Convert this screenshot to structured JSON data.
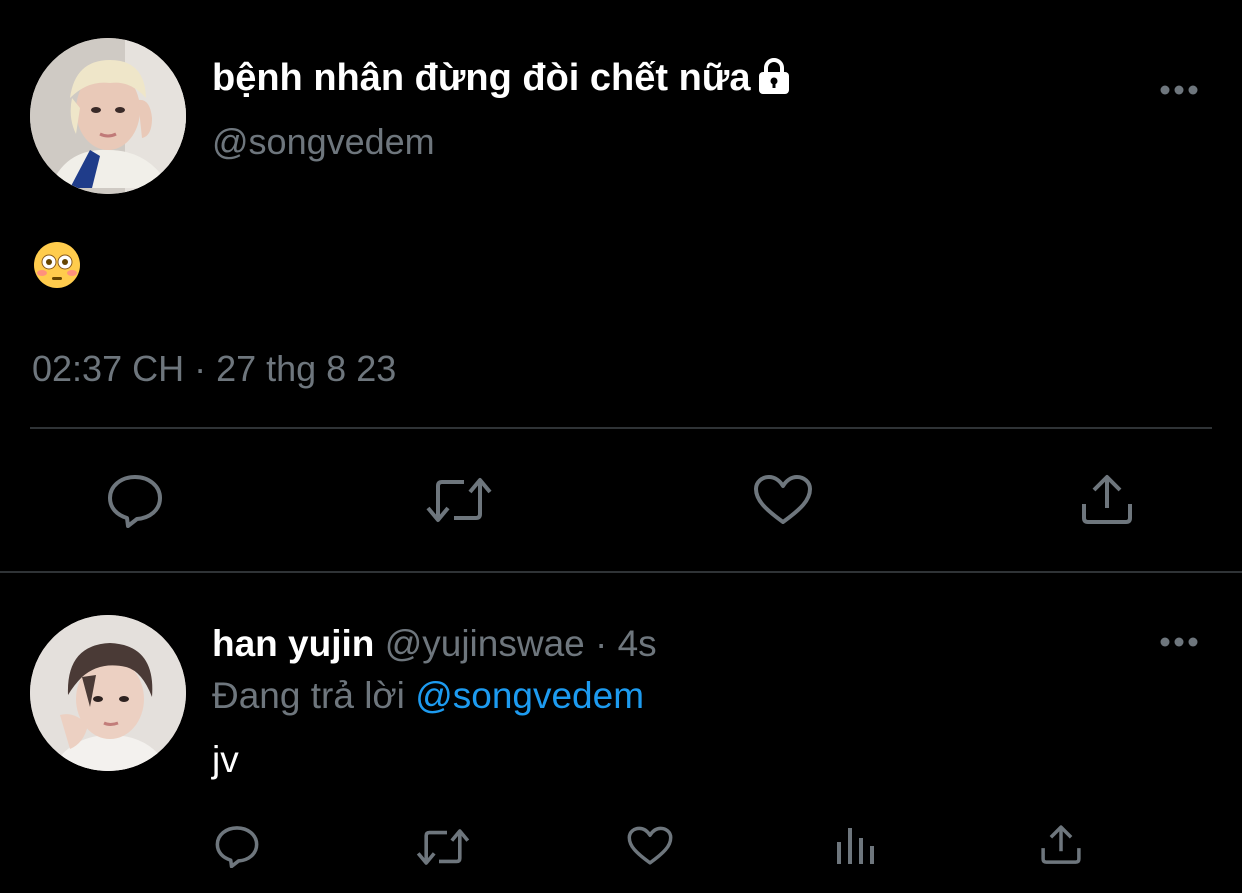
{
  "main_tweet": {
    "display_name": "bệnh nhân đừng đòi chết nữa",
    "handle": "@songvedem",
    "content_emoji": "flushed-face",
    "timestamp": "02:37 CH · 27 thg 8 23",
    "actions": [
      "reply-icon",
      "retweet-icon",
      "like-icon",
      "share-icon"
    ]
  },
  "reply_tweet": {
    "display_name": "han yujin",
    "handle": "@yujinswae",
    "separator": " · ",
    "time_ago": "4s",
    "replying_prefix": "Đang trả lời ",
    "replying_to": "@songvedem",
    "text": "jv",
    "actions": [
      "reply-icon",
      "retweet-icon",
      "like-icon",
      "analytics-icon",
      "share-icon"
    ]
  },
  "colors": {
    "background": "#000000",
    "primary_text": "#ffffff",
    "secondary_text": "#6e767d",
    "accent": "#1d9bf0",
    "divider": "#2f3336"
  }
}
